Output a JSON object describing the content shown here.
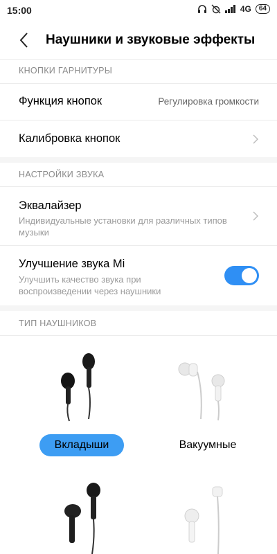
{
  "status": {
    "time": "15:00",
    "network": "4G",
    "battery": "64"
  },
  "header": {
    "title": "Наушники и звуковые эффекты"
  },
  "sections": {
    "buttons": {
      "header": "КНОПКИ ГАРНИТУРЫ",
      "function_label": "Функция кнопок",
      "function_value": "Регулировка громкости",
      "calibration_label": "Калибровка кнопок"
    },
    "sound": {
      "header": "НАСТРОЙКИ ЗВУКА",
      "equalizer_label": "Эквалайзер",
      "equalizer_sub": "Индивидуальные установки для различных типов музыки",
      "mi_sound_label": "Улучшение звука Mi",
      "mi_sound_sub": "Улучшить качество звука при воспроизведении через наушники",
      "mi_sound_enabled": true
    },
    "type": {
      "header": "ТИП НАУШНИКОВ",
      "options": [
        {
          "label": "Вкладыши",
          "selected": true,
          "color": "black"
        },
        {
          "label": "Вакуумные",
          "selected": false,
          "color": "white"
        }
      ]
    }
  },
  "colors": {
    "accent": "#2f8ff4",
    "selected_button": "#3d9df3"
  }
}
